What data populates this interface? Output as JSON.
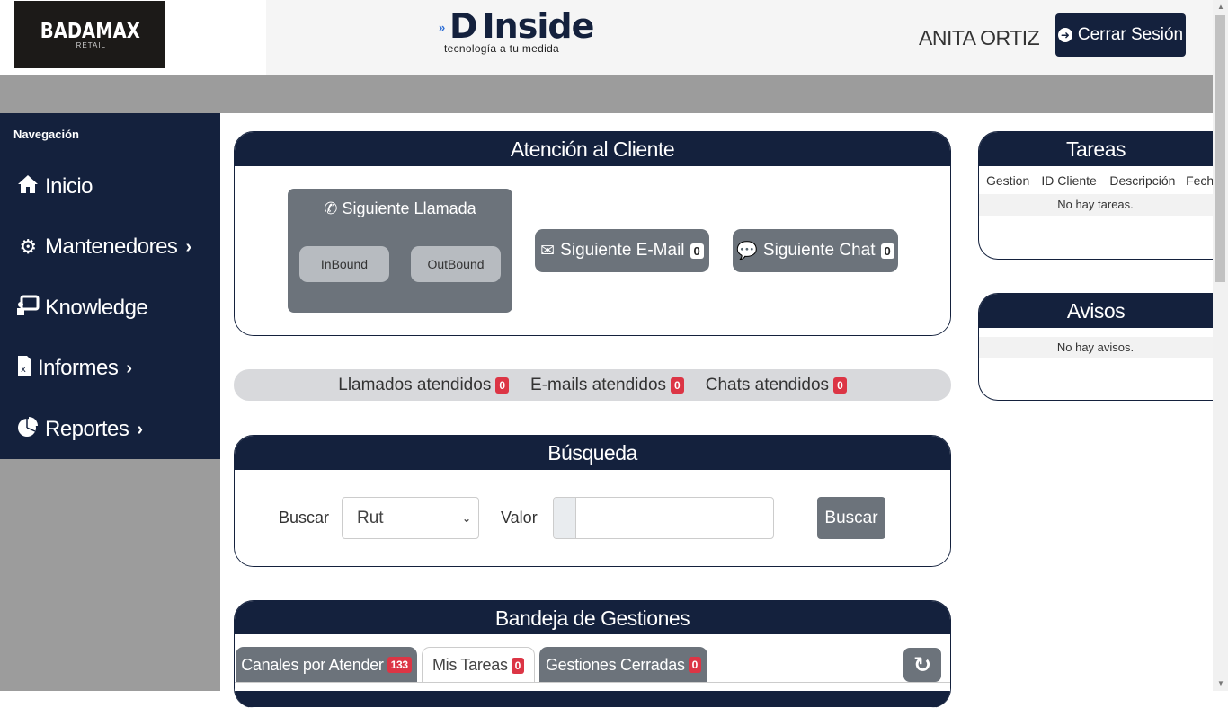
{
  "header": {
    "logo_brand": "BADAMAX",
    "logo_sub": "RETAIL",
    "partner_logo_word": "Inside",
    "partner_logo_letter": "D",
    "partner_tagline": "tecnología a tu medida",
    "user_name": "ANITA ORTIZ",
    "logout_label": "Cerrar Sesión"
  },
  "sidebar": {
    "title": "Navegación",
    "items": [
      {
        "label": "Inicio",
        "icon": "home-icon"
      },
      {
        "label": "Mantenedores",
        "icon": "gears-icon"
      },
      {
        "label": "Knowledge",
        "icon": "chalkboard-icon"
      },
      {
        "label": "Informes",
        "icon": "excel-file-icon"
      },
      {
        "label": "Reportes",
        "icon": "pie-chart-icon"
      }
    ]
  },
  "atencion": {
    "title": "Atención al Cliente",
    "next_call": "Siguiente Llamada",
    "inbound": "InBound",
    "outbound": "OutBound",
    "next_email": "Siguiente E-Mail",
    "next_email_count": "0",
    "next_chat": "Siguiente Chat",
    "next_chat_count": "0"
  },
  "stats": {
    "calls_label": "Llamados atendidos",
    "calls_count": "0",
    "emails_label": "E-mails atendidos",
    "emails_count": "0",
    "chats_label": "Chats atendidos",
    "chats_count": "0"
  },
  "busqueda": {
    "title": "Búsqueda",
    "buscar_label": "Buscar",
    "select_value": "Rut",
    "valor_label": "Valor",
    "input_value": "",
    "button_label": "Buscar"
  },
  "bandeja": {
    "title": "Bandeja de Gestiones",
    "tabs": [
      {
        "label": "Canales por Atender",
        "count": "133"
      },
      {
        "label": "Mis Tareas",
        "count": "0"
      },
      {
        "label": "Gestiones Cerradas",
        "count": "0"
      }
    ]
  },
  "tareas": {
    "title": "Tareas",
    "columns": [
      "Gestion",
      "ID Cliente",
      "Descripción",
      "Fech"
    ],
    "empty": "No hay tareas."
  },
  "avisos": {
    "title": "Avisos",
    "empty": "No hay avisos."
  },
  "colors": {
    "navy": "#14213d",
    "grey_button": "#6c737b",
    "badge_red": "#dc3545"
  }
}
